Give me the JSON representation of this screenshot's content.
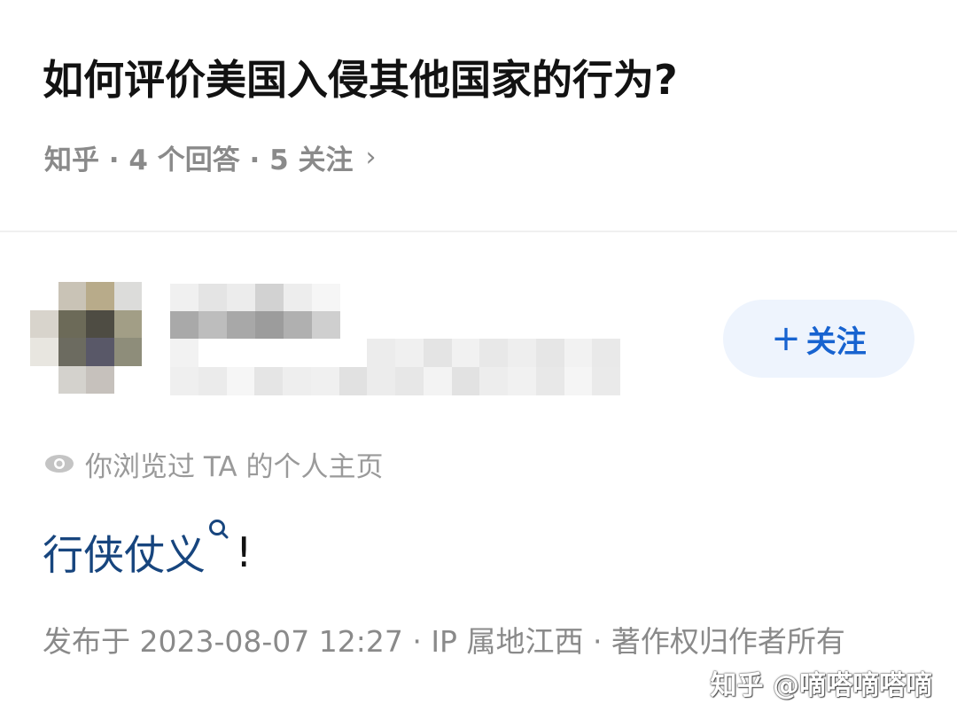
{
  "question": {
    "title": "如何评价美国入侵其他国家的行为?",
    "meta": "知乎 · 4 个回答 · 5 关注",
    "chevron_icon": "chevron-right-icon"
  },
  "author": {
    "avatar_icon": "pixelated-avatar",
    "name_redacted": true,
    "bio_redacted": true,
    "follow_button_label": "关注",
    "follow_icon": "plus-icon",
    "accent_color": "#1763d0"
  },
  "viewed": {
    "icon": "eye-icon",
    "text": "你浏览过 TA 的个人主页"
  },
  "answer": {
    "link_text": "行侠仗义",
    "link_icon": "search-icon",
    "trailing": "!"
  },
  "publish": {
    "text": "发布于 2023-08-07 12:27 · IP 属地江西 · 著作权归作者所有"
  },
  "watermark": {
    "text": "知乎 @嘀嗒嘀嗒嘀"
  }
}
